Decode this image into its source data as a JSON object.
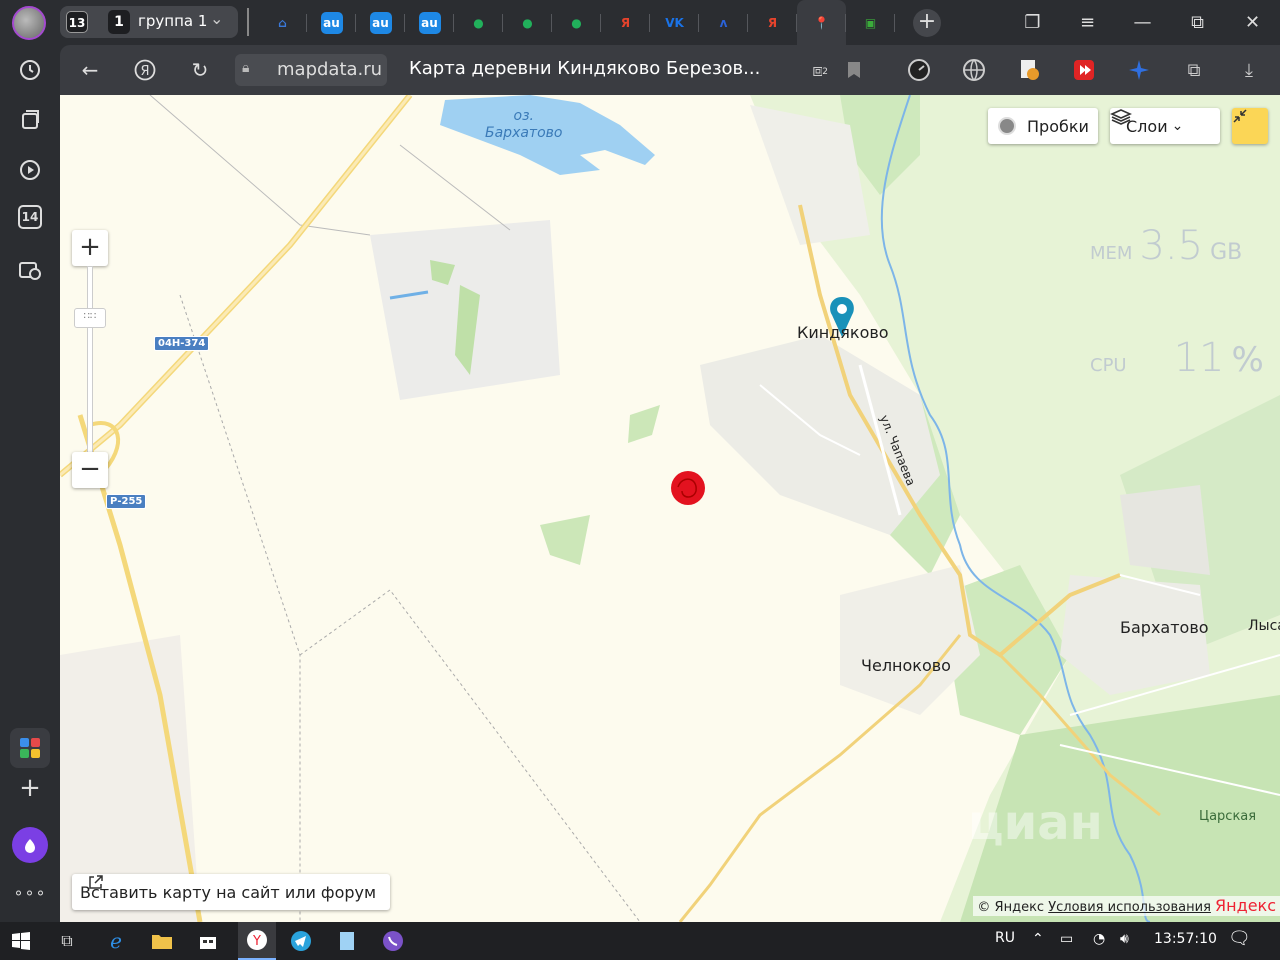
{
  "tabbar": {
    "group_count": "13",
    "group_badge": "1",
    "group_name": "группа 1",
    "tabs": [
      {
        "name": "home",
        "glyph": "⌂",
        "color": "#3a78d8"
      },
      {
        "name": "avito-1",
        "glyph": "au",
        "color": "#1e88e5"
      },
      {
        "name": "avito-2",
        "glyph": "au",
        "color": "#1e88e5"
      },
      {
        "name": "avito-3",
        "glyph": "au",
        "color": "#1e88e5"
      },
      {
        "name": "dots-1",
        "glyph": "●",
        "color": "#21b05b"
      },
      {
        "name": "dots-2",
        "glyph": "●",
        "color": "#21b05b"
      },
      {
        "name": "dots-3",
        "glyph": "●",
        "color": "#21b05b"
      },
      {
        "name": "yandex-1",
        "glyph": "Я",
        "color": "#e6432c"
      },
      {
        "name": "vk",
        "glyph": "VK",
        "color": "#1a73e8"
      },
      {
        "name": "lambda",
        "glyph": "ʌ",
        "color": "#2a62d8"
      },
      {
        "name": "yandex-2",
        "glyph": "Я",
        "color": "#e6432c"
      },
      {
        "name": "mapdata",
        "glyph": "📍",
        "color": "#2a9ec2"
      },
      {
        "name": "green-app",
        "glyph": "▣",
        "color": "#3bab3b"
      }
    ]
  },
  "addressbar": {
    "domain": "mapdata.ru",
    "title": "Карта деревни Киндяково Березов...",
    "badge": "2"
  },
  "sidebar": {
    "badge_number": "14"
  },
  "map": {
    "lake_label": "оз.\nБархатово",
    "places": {
      "kindyakovo": "Киндяково",
      "chelnokovo": "Челноково",
      "barkhatovo": "Бархатово",
      "lysaya": "Лыса",
      "tsarskaya": "Царская",
      "street": "ул. Чапаева"
    },
    "roads": {
      "r1": "04Н-374",
      "r2": "Р-255"
    },
    "traffic_label": "Пробки",
    "layers_label": "Слои",
    "embed_label": "Вставить карту на сайт или форум",
    "copyright": "© Яндекс",
    "terms_label": "Условия использования",
    "brand": "Яндекс",
    "watermark": "циан"
  },
  "overlay": {
    "mem_label": "MEM",
    "mem_value": "3.5",
    "mem_unit": "GB",
    "cpu_label": "CPU",
    "cpu_value": "11",
    "cpu_unit": "%"
  },
  "taskbar": {
    "lang": "RU",
    "time": "13:57:10"
  }
}
